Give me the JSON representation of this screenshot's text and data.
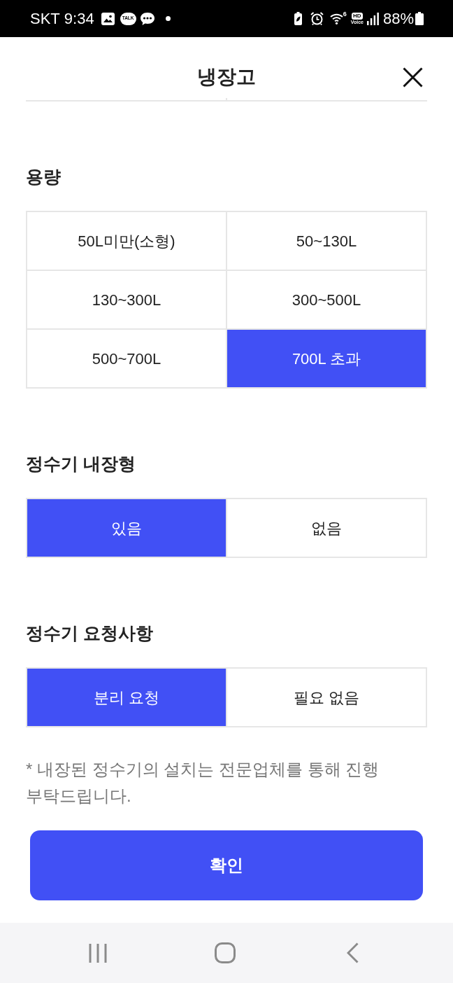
{
  "status_bar": {
    "carrier": "SKT",
    "time": "9:34",
    "talk_badge": "TALK",
    "wifi_generation": "6",
    "hd_badge": "HD",
    "voice_label": "Voice",
    "battery": "88%"
  },
  "header": {
    "title": "냉장고"
  },
  "sections": [
    {
      "title": "용량",
      "options": [
        {
          "label": "50L미만(소형)",
          "selected": false
        },
        {
          "label": "50~130L",
          "selected": false
        },
        {
          "label": "130~300L",
          "selected": false
        },
        {
          "label": "300~500L",
          "selected": false
        },
        {
          "label": "500~700L",
          "selected": false
        },
        {
          "label": "700L 초과",
          "selected": true
        }
      ]
    },
    {
      "title": "정수기 내장형",
      "options": [
        {
          "label": "있음",
          "selected": true
        },
        {
          "label": "없음",
          "selected": false
        }
      ]
    },
    {
      "title": "정수기 요청사항",
      "options": [
        {
          "label": "분리 요청",
          "selected": true
        },
        {
          "label": "필요 없음",
          "selected": false
        }
      ]
    }
  ],
  "note": "* 내장된 정수기의 설치는 전문업체를 통해 진행 부탁드립니다.",
  "confirm_button": "확인"
}
